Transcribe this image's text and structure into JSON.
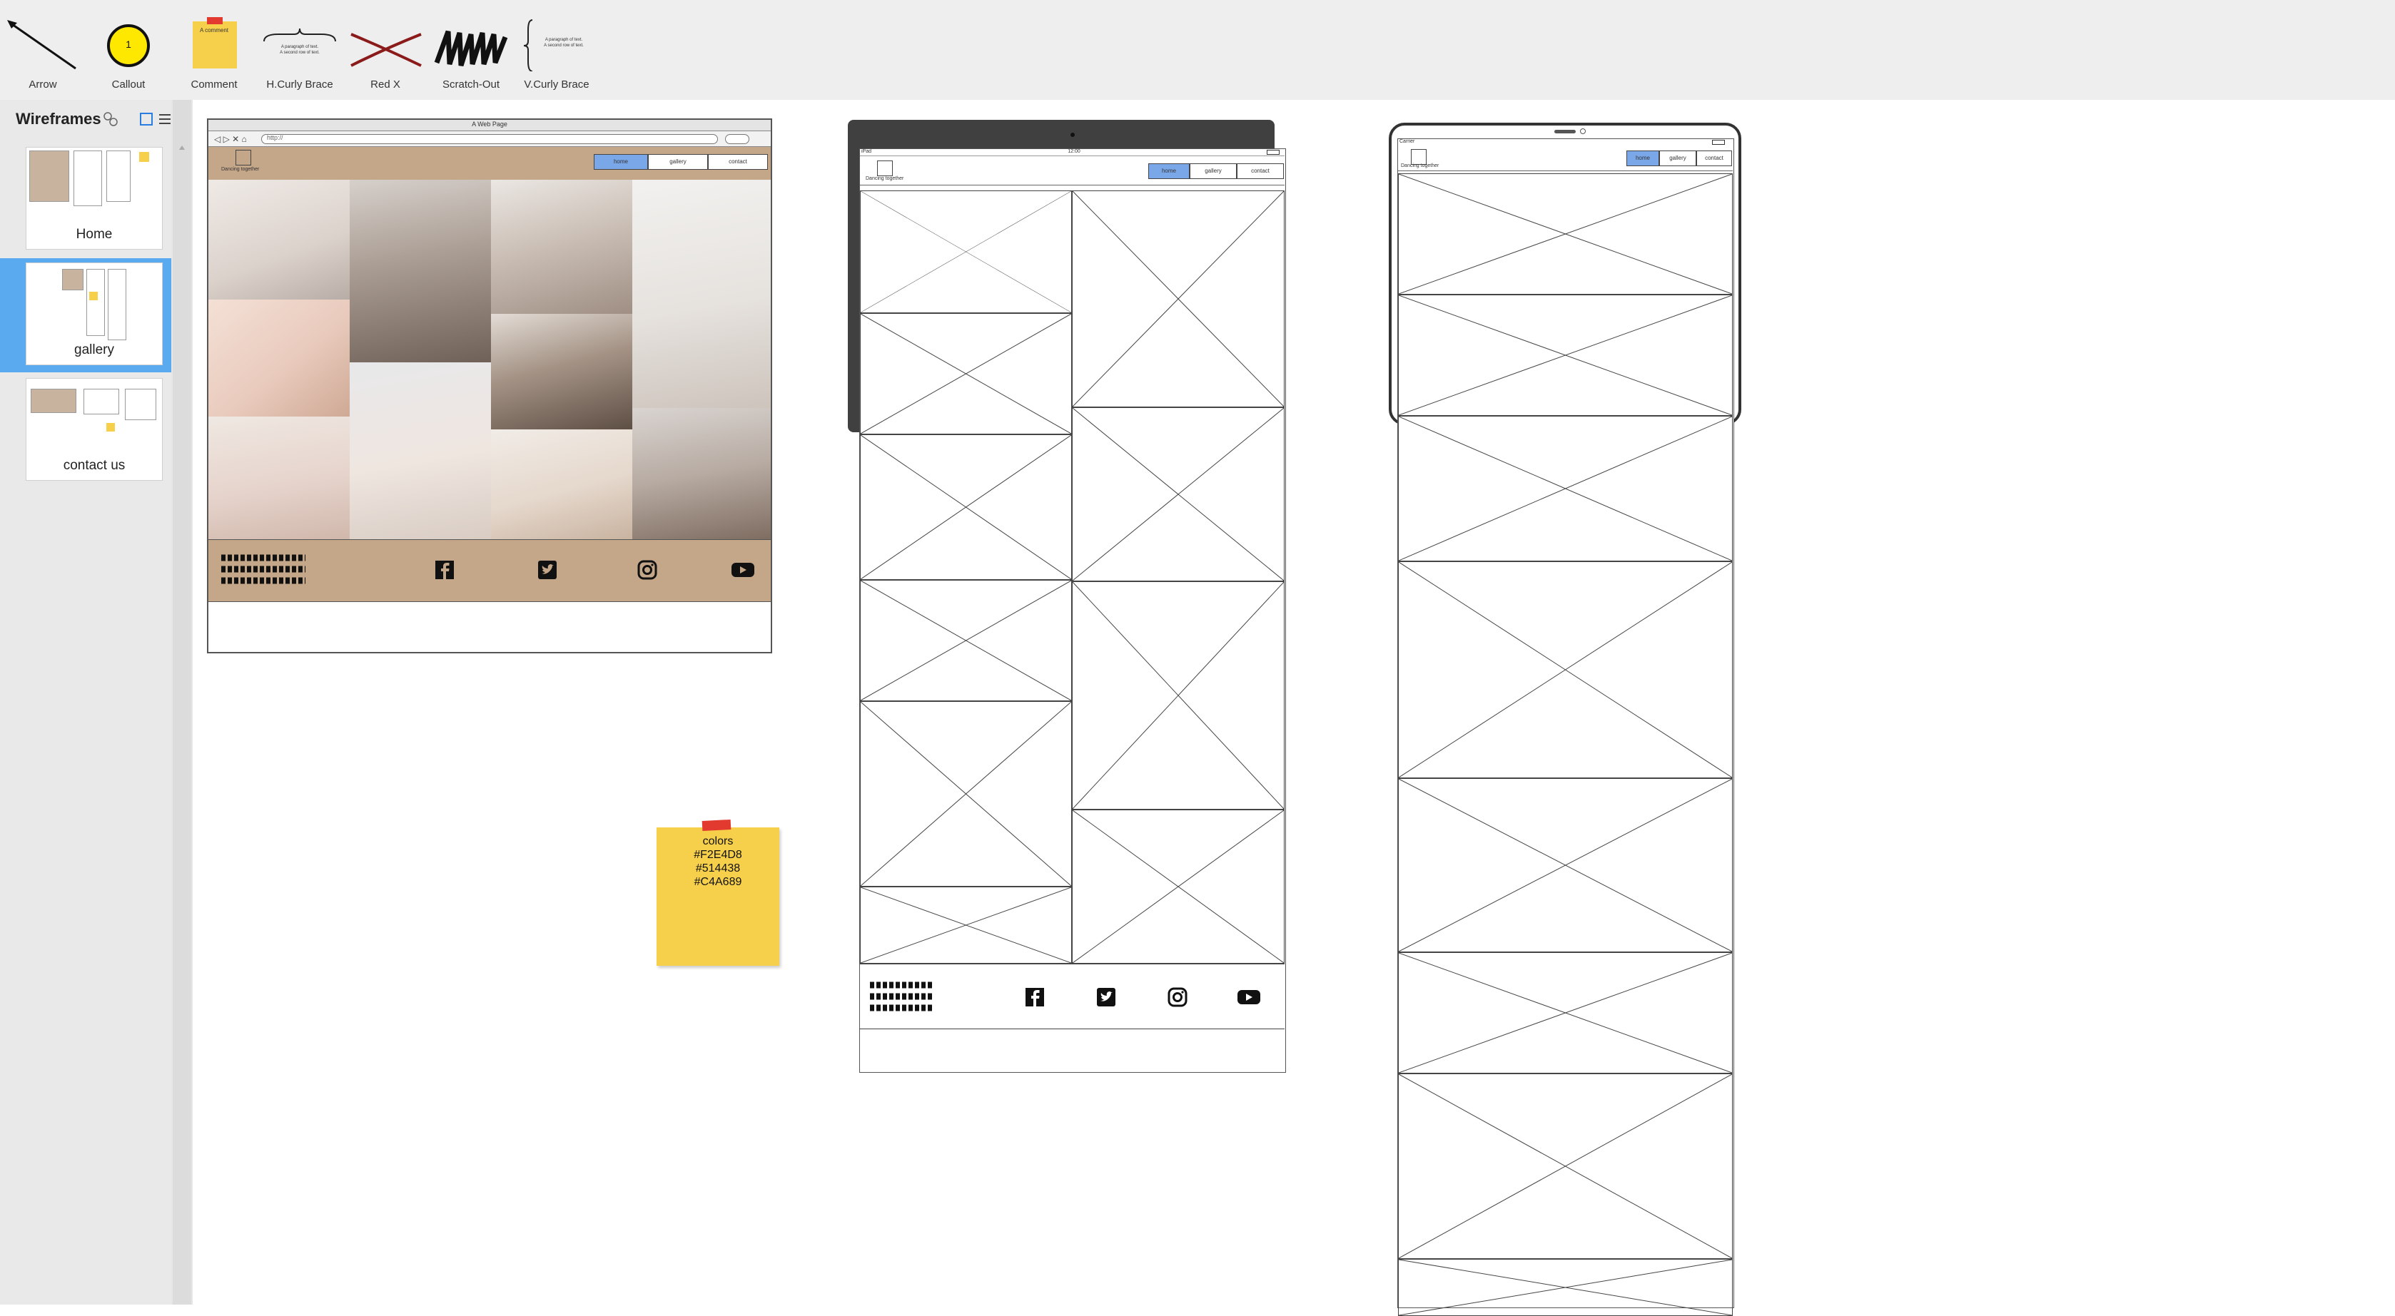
{
  "toolbar": {
    "items": [
      {
        "label": "Arrow",
        "icon": "arrow-icon"
      },
      {
        "label": "Callout",
        "icon": "callout-icon",
        "badge": "1"
      },
      {
        "label": "Comment",
        "icon": "comment-icon",
        "note": "A comment"
      },
      {
        "label": "H.Curly Brace",
        "icon": "h-curly-brace-icon",
        "text1": "A paragraph of text.",
        "text2": "A second row of text."
      },
      {
        "label": "Red X",
        "icon": "red-x-icon"
      },
      {
        "label": "Scratch-Out",
        "icon": "scratch-out-icon"
      },
      {
        "label": "V.Curly Brace",
        "icon": "v-curly-brace-icon",
        "text1": "A paragraph of text.",
        "text2": "A second row of text."
      }
    ]
  },
  "sidebar": {
    "title": "Wireframes",
    "pages": [
      {
        "label": "Home",
        "selected": false
      },
      {
        "label": "gallery",
        "selected": true
      },
      {
        "label": "contact us",
        "selected": false
      }
    ]
  },
  "desktop_frame": {
    "window_title": "A Web Page",
    "url": "http://",
    "logo_caption": "Dancing together",
    "nav": [
      "home",
      "gallery",
      "contact"
    ],
    "active_nav": 0,
    "header_color": "#C4A689",
    "footer_color": "#C4A689"
  },
  "tablet_frame": {
    "status_left": "iPad",
    "status_time": "12:00",
    "logo_caption": "Dancing together",
    "nav": [
      "home",
      "gallery",
      "contact"
    ],
    "active_nav": 0
  },
  "phone_frame": {
    "status_left": "Carrier",
    "logo_caption": "Dancing together",
    "nav": [
      "home",
      "gallery",
      "contact"
    ],
    "active_nav": 0
  },
  "sticky_note": {
    "lines": [
      "colors",
      "#F2E4D8",
      "#514438",
      "#C4A689"
    ]
  },
  "colors": {
    "accent": "#7aa7e8",
    "selection": "#5aaaf0",
    "sticky": "#f7d04b",
    "brand_tan": "#C4A689"
  }
}
